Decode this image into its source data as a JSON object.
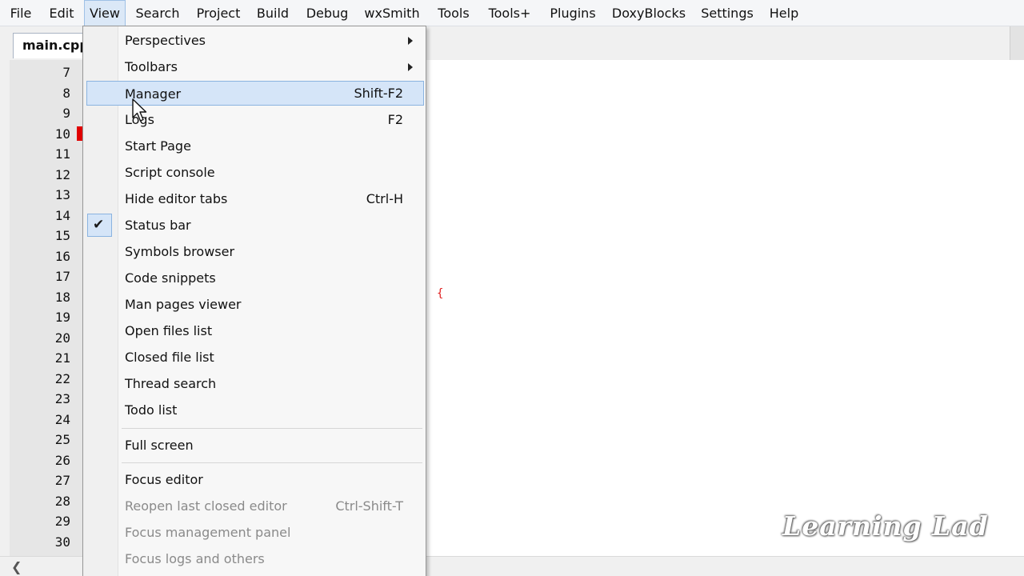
{
  "menubar": {
    "items": [
      {
        "label": "File",
        "active": false
      },
      {
        "label": "Edit",
        "active": false
      },
      {
        "label": "View",
        "active": true
      },
      {
        "label": "Search",
        "active": false
      },
      {
        "label": "Project",
        "active": false
      },
      {
        "label": "Build",
        "active": false
      },
      {
        "label": "Debug",
        "active": false
      },
      {
        "label": "wxSmith",
        "active": false
      },
      {
        "label": "Tools",
        "active": false
      },
      {
        "label": "Tools+",
        "active": false
      },
      {
        "label": "Plugins",
        "active": false
      },
      {
        "label": "DoxyBlocks",
        "active": false
      },
      {
        "label": "Settings",
        "active": false
      },
      {
        "label": "Help",
        "active": false
      }
    ]
  },
  "editor": {
    "tab_label": "main.cpp",
    "line_numbers": [
      "7",
      "8",
      "9",
      "10",
      "11",
      "12",
      "13",
      "14",
      "15",
      "16",
      "17",
      "18",
      "19",
      "20",
      "21",
      "22",
      "23",
      "24",
      "25",
      "26",
      "27",
      "28",
      "29",
      "30"
    ],
    "visible_code_fragment": "{"
  },
  "view_menu": {
    "items": [
      {
        "label": "Perspectives",
        "shortcut": "",
        "submenu": true,
        "checked": false,
        "disabled": false,
        "highlighted": false
      },
      {
        "label": "Toolbars",
        "shortcut": "",
        "submenu": true,
        "checked": false,
        "disabled": false,
        "highlighted": false
      },
      {
        "label": "Manager",
        "shortcut": "Shift-F2",
        "submenu": false,
        "checked": false,
        "disabled": false,
        "highlighted": true
      },
      {
        "label": "Logs",
        "shortcut": "F2",
        "submenu": false,
        "checked": false,
        "disabled": false,
        "highlighted": false
      },
      {
        "label": "Start Page",
        "shortcut": "",
        "submenu": false,
        "checked": false,
        "disabled": false,
        "highlighted": false
      },
      {
        "label": "Script console",
        "shortcut": "",
        "submenu": false,
        "checked": false,
        "disabled": false,
        "highlighted": false
      },
      {
        "label": "Hide editor tabs",
        "shortcut": "Ctrl-H",
        "submenu": false,
        "checked": false,
        "disabled": false,
        "highlighted": false
      },
      {
        "label": "Status bar",
        "shortcut": "",
        "submenu": false,
        "checked": true,
        "disabled": false,
        "highlighted": false
      },
      {
        "label": "Symbols browser",
        "shortcut": "",
        "submenu": false,
        "checked": false,
        "disabled": false,
        "highlighted": false
      },
      {
        "label": "Code snippets",
        "shortcut": "",
        "submenu": false,
        "checked": false,
        "disabled": false,
        "highlighted": false
      },
      {
        "label": "Man pages viewer",
        "shortcut": "",
        "submenu": false,
        "checked": false,
        "disabled": false,
        "highlighted": false
      },
      {
        "label": "Open files list",
        "shortcut": "",
        "submenu": false,
        "checked": false,
        "disabled": false,
        "highlighted": false
      },
      {
        "label": "Closed file list",
        "shortcut": "",
        "submenu": false,
        "checked": false,
        "disabled": false,
        "highlighted": false
      },
      {
        "label": "Thread search",
        "shortcut": "",
        "submenu": false,
        "checked": false,
        "disabled": false,
        "highlighted": false
      },
      {
        "label": "Todo list",
        "shortcut": "",
        "submenu": false,
        "checked": false,
        "disabled": false,
        "highlighted": false
      },
      {
        "label": "Full screen",
        "shortcut": "",
        "submenu": false,
        "checked": false,
        "disabled": false,
        "highlighted": false
      },
      {
        "label": "Focus editor",
        "shortcut": "",
        "submenu": false,
        "checked": false,
        "disabled": false,
        "highlighted": false
      },
      {
        "label": "Reopen last closed editor",
        "shortcut": "Ctrl-Shift-T",
        "submenu": false,
        "checked": false,
        "disabled": true,
        "highlighted": false
      },
      {
        "label": "Focus management panel",
        "shortcut": "",
        "submenu": false,
        "checked": false,
        "disabled": true,
        "highlighted": false
      },
      {
        "label": "Focus logs and others",
        "shortcut": "",
        "submenu": false,
        "checked": false,
        "disabled": true,
        "highlighted": false
      }
    ]
  },
  "watermark": "Learning Lad",
  "colors": {
    "menu_highlight": "#d5e5f8",
    "menu_highlight_border": "#8ab3e0",
    "breakpoint_marker": "#e00000",
    "disabled_text": "#8a8a8a"
  }
}
